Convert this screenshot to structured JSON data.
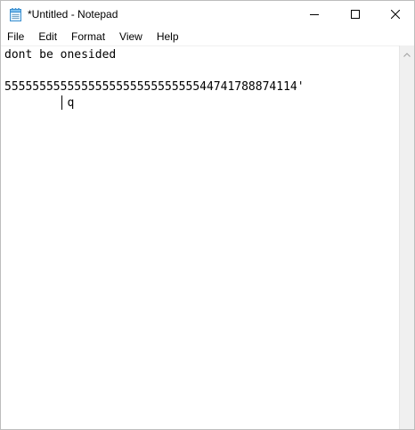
{
  "window": {
    "title": "*Untitled - Notepad",
    "app_icon": "notepad-icon"
  },
  "caption_buttons": {
    "minimize_icon": "minimize-icon",
    "maximize_icon": "maximize-icon",
    "close_icon": "close-icon"
  },
  "menu": {
    "items": [
      {
        "label": "File"
      },
      {
        "label": "Edit"
      },
      {
        "label": "Format"
      },
      {
        "label": "View"
      },
      {
        "label": "Help"
      }
    ]
  },
  "editor": {
    "content": "dont be onesided\n\n555555555555555555555555555544741788874114'\n         q"
  },
  "scrollbar": {
    "up_arrow_icon": "scroll-up-arrow-icon"
  }
}
